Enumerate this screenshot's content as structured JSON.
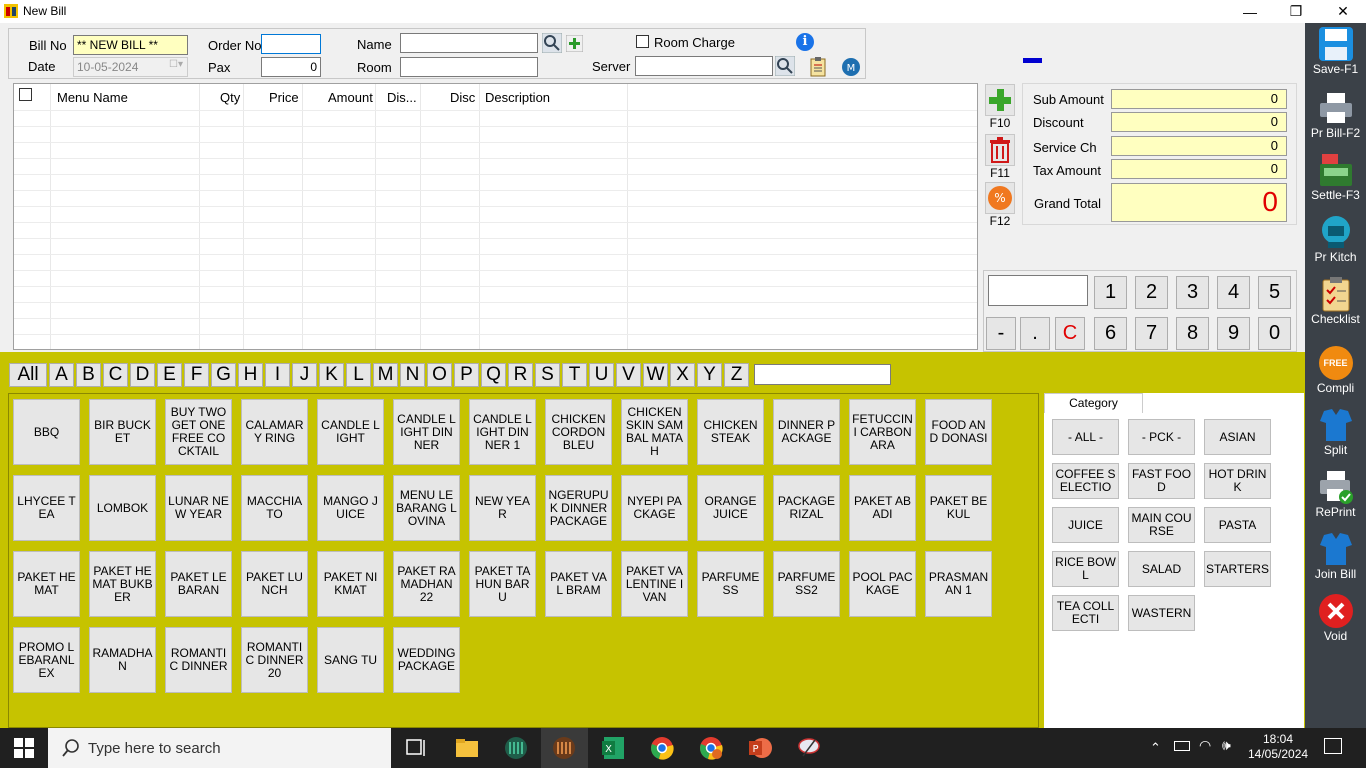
{
  "window": {
    "title": "New Bill",
    "minimize": "—",
    "restore": "❐",
    "close": "✕"
  },
  "header": {
    "bill_no_label": "Bill No",
    "bill_no_value": "** NEW BILL **",
    "date_label": "Date",
    "date_value": "10-05-2024",
    "order_no_label": "Order No",
    "order_no_value": "",
    "pax_label": "Pax",
    "pax_value": "0",
    "name_label": "Name",
    "name_value": "",
    "room_label": "Room",
    "room_value": "",
    "room_charge_label": "Room Charge",
    "server_label": "Server",
    "server_value": ""
  },
  "grid": {
    "columns": [
      "Menu Name",
      "Qty",
      "Price",
      "Amount",
      "Dis...",
      "Disc",
      "Description"
    ]
  },
  "side_buttons": {
    "add_label": "F10",
    "delete_label": "F11",
    "discount_label": "F12"
  },
  "totals": {
    "sub_amount_label": "Sub Amount",
    "sub_amount": "0",
    "discount_label": "Discount",
    "discount": "0",
    "service_label": "Service Ch",
    "service": "0",
    "tax_label": "Tax Amount",
    "tax": "0",
    "grand_total_label": "Grand Total",
    "grand_total": "0"
  },
  "keypad": {
    "display": "",
    "row1": [
      "1",
      "2",
      "3",
      "4",
      "5"
    ],
    "row2": [
      "-",
      ".",
      "C",
      "6",
      "7",
      "8",
      "9",
      "0"
    ]
  },
  "alphabet": [
    "All",
    "A",
    "B",
    "C",
    "D",
    "E",
    "F",
    "G",
    "H",
    "I",
    "J",
    "K",
    "L",
    "M",
    "N",
    "O",
    "P",
    "Q",
    "R",
    "S",
    "T",
    "U",
    "V",
    "W",
    "X",
    "Y",
    "Z"
  ],
  "menu_items": [
    "BBQ",
    "BIR BUCKET",
    "BUY TWO GET ONE FREE COCKTAIL",
    "CALAMARY RING",
    "CANDLE LIGHT",
    "CANDLE LIGHT DINNER",
    "CANDLE LIGHT DINNER 1",
    "CHICKEN CORDON BLEU",
    "CHICKEN SKIN SAMBAL MATAH",
    "CHICKEN STEAK",
    "DINNER PACKAGE",
    "FETUCCINI CARBONARA",
    "FOOD AND DONASI",
    "LHYCEE TEA",
    "LOMBOK",
    "LUNAR NEW YEAR",
    "MACCHIATO",
    "MANGO JUICE",
    "MENU LEBARANG LOVINA",
    "NEW YEAR",
    "NGERUPUK DINNER PACKAGE",
    "NYEPI PACKAGE",
    "ORANGE JUICE",
    "PACKAGE RIZAL",
    "PAKET ABADI",
    "PAKET BEKUL",
    "PAKET HEMAT",
    "PAKET HEMAT BUKBER",
    "PAKET LEBARAN",
    "PAKET LUNCH",
    "PAKET NIKMAT",
    "PAKET RAMADHAN 22",
    "PAKET TAHUN BARU",
    "PAKET VAL BRAM",
    "PAKET VALENTINE IVAN",
    "PARFUMESS",
    "PARFUMESS2",
    "POOL PACKAGE",
    "PRASMANAN 1",
    "PROMO LEBARANLEX",
    "RAMADHAN",
    "ROMANTIC DINNER",
    "ROMANTIC DINNER 20",
    "SANG TU",
    "WEDDING PACKAGE"
  ],
  "category": {
    "tab_label": "Category",
    "items": [
      "- ALL -",
      "- PCK -",
      "ASIAN",
      "COFFEE SELECTIO",
      "FAST FOOD",
      "HOT DRINK",
      "JUICE",
      "MAIN COURSE",
      "PASTA",
      "RICE BOWL",
      "SALAD",
      "STARTERS",
      "TEA COLLECTI",
      "WASTERN"
    ]
  },
  "toolbar": {
    "save": "Save-F1",
    "print_bill": "Pr Bill-F2",
    "settle": "Settle-F3",
    "print_kitchen": "Pr Kitch",
    "checklist": "Checklist",
    "compli": "Compli",
    "compli_badge": "FREE",
    "split": "Split",
    "reprint": "RePrint",
    "join_bill": "Join Bill",
    "void": "Void"
  },
  "taskbar": {
    "search_placeholder": "Type here to search",
    "time": "18:04",
    "date": "14/05/2024"
  },
  "colors": {
    "olive": "#c6c300",
    "field_yellow": "#ffffc0",
    "toolbar": "#3b4148",
    "grand_total_red": "#e00000"
  }
}
